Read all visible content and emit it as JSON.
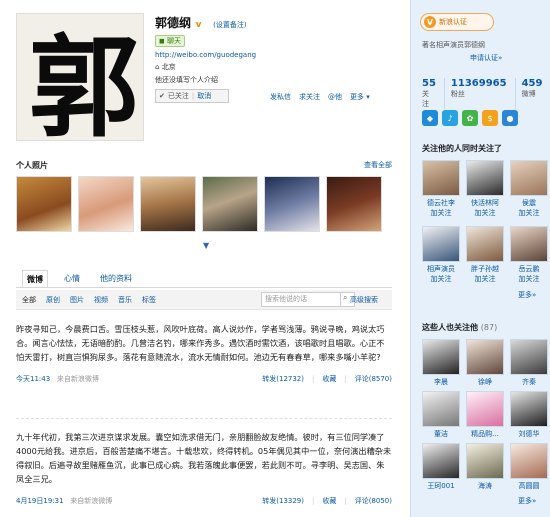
{
  "profile": {
    "name": "郭德纲",
    "verified": "v",
    "set_note": "(设置备注)",
    "chat": "聊天",
    "url": "http://weibo.com/guodegang",
    "location": "北京",
    "intro": "他还没填写个人介绍",
    "followed_label": "已关注",
    "cancel_label": "取消",
    "actions": [
      "发私信",
      "求关注",
      "@他",
      "更多"
    ],
    "avatar_char": "郭"
  },
  "photos": {
    "title": "个人照片",
    "view_all": "查看全部"
  },
  "tabs": [
    "微博",
    "心情",
    "他的资料"
  ],
  "filters": [
    "全部",
    "原创",
    "图片",
    "视频",
    "音乐",
    "标签"
  ],
  "search": {
    "placeholder": "搜索他说的话",
    "advanced": "高级搜索"
  },
  "posts": [
    {
      "text": "昨夜寻知己，今晨费口舌。雪压枝头惹，风吹叶底荷。高人说炒作，学者骂浅薄。鸦说寻晚，鸡说太巧合。闻言心怯怯，无语暗酌酌。几曾洁名钓，哪来作秀多。遇饮酒时需饮酒，该唱歌时且唱歌。心正不怕天雷打，树直岂惧狗尿多。落花有意随流水，流水无情耐如何。池边无有春春草，哪来多嘴小羊驼?",
      "time": "今天11:43",
      "source": "来自新浪微博",
      "repost": "转发(12732)",
      "fav": "收藏",
      "comment": "评论(8570)"
    },
    {
      "text": "九十年代初，我第三次进京谋求发展。囊空如洗求借无门，亲朋翻脸故友绝情。彼时，有三位同学凑了4000元给我。进京后，百般苦楚痛不堪言。十载悲欢，终得转机。05年偶见其中一位，奈何演出糟杂未得叙旧。后遍寻故里赌雁鱼沉，此事已成心病。我若落魄此事便罢，若此则不可。寻李明、吴志国、朱凤全三兄。",
      "time": "4月19日19:31",
      "source": "来自新浪微博",
      "repost": "转发(13329)",
      "fav": "收藏",
      "comment": "评论(8050)"
    }
  ],
  "sidebar": {
    "badge": "新浪认证",
    "title_note": "著名相声演员郭德纲",
    "apply": "申请认证»",
    "stats": [
      {
        "n": "55",
        "l": "关注"
      },
      {
        "n": "11369965",
        "l": "粉丝"
      },
      {
        "n": "459",
        "l": "微博"
      }
    ],
    "common_title": "关注他的人同时关注了",
    "common": [
      {
        "name": "德云社李",
        "follow": "加关注"
      },
      {
        "name": "快活林阿",
        "follow": "加关注"
      },
      {
        "name": "侯震",
        "follow": "加关注"
      },
      {
        "name": "相声演员",
        "follow": "加关注"
      },
      {
        "name": "胖子孙越",
        "follow": "加关注"
      },
      {
        "name": "岳云鹏",
        "follow": "加关注"
      }
    ],
    "more": "更多»",
    "following_title": "这些人也关注他",
    "following_count": "(87)",
    "following": [
      {
        "name": "李晨"
      },
      {
        "name": "徐峥"
      },
      {
        "name": "齐秦"
      },
      {
        "name": "董洁"
      },
      {
        "name": "精品购..."
      },
      {
        "name": "刘德华"
      },
      {
        "name": "王珂001"
      },
      {
        "name": "海涛"
      },
      {
        "name": "高圆圆"
      }
    ],
    "more2": "更多»"
  }
}
